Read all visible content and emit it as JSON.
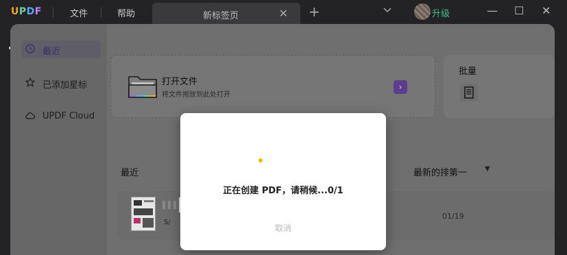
{
  "titlebar": {
    "logo": {
      "u": "U",
      "p": "P",
      "d": "D",
      "f": "F"
    },
    "menu": {
      "file": "文件",
      "help": "帮助"
    },
    "tab": {
      "label": "新标签页",
      "close": "✕"
    },
    "new_tab": "+",
    "upgrade": "升级",
    "window": {
      "minimize": "—",
      "maximize": "☐",
      "close": "✕"
    }
  },
  "sidebar": {
    "items": [
      {
        "label": "最近",
        "icon": "clock-icon"
      },
      {
        "label": "已添加星标",
        "icon": "star-icon"
      },
      {
        "label": "UPDF Cloud",
        "icon": "cloud-icon"
      }
    ]
  },
  "open_card": {
    "title": "打开文件",
    "subtitle": "将文件拖放到此处打开",
    "arrow": "›"
  },
  "batch_card": {
    "title": "批量"
  },
  "recent": {
    "title": "最近",
    "sort_label": "最新的排第一",
    "sort_caret": "▼",
    "files": [
      {
        "meta": "S/",
        "date": "01/19"
      }
    ]
  },
  "dialog": {
    "progress_text": "正在创建 PDF，请稍候...0/1",
    "cancel": "取消"
  },
  "colors": {
    "accent": "#5b3f8c",
    "spinner": "#f5b400",
    "upgrade": "#3fbf8a"
  }
}
